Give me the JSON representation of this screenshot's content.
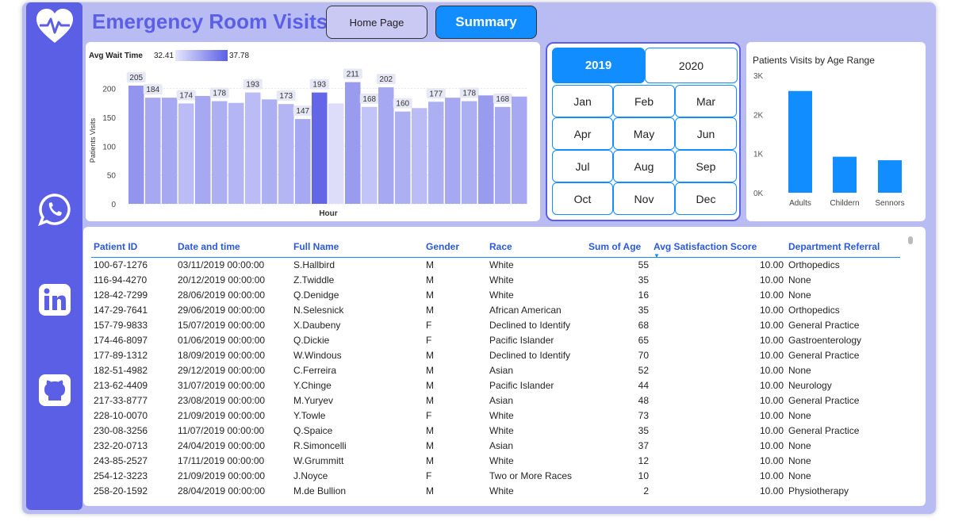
{
  "app": {
    "title": "Emergency Room Visits",
    "home_button": "Home Page",
    "summary_button": "Summary",
    "accent": "#5b5fe6",
    "brand_blue": "#118dff"
  },
  "sidebar": {
    "icons": [
      "heart-pulse-icon",
      "whatsapp-icon",
      "linkedin-icon",
      "github-icon"
    ]
  },
  "chart_data": [
    {
      "type": "bar",
      "title": "",
      "xlabel": "Hour",
      "ylabel": "Patients Visits",
      "ylim": [
        0,
        220
      ],
      "yticks": [
        0,
        50,
        100,
        150,
        200
      ],
      "legend": {
        "label": "Avg Wait Time",
        "min": "32.41",
        "max": "37.78"
      },
      "values": [
        205,
        184,
        184,
        174,
        187,
        178,
        175,
        193,
        181,
        173,
        147,
        193,
        174,
        211,
        168,
        202,
        160,
        166,
        177,
        184,
        178,
        188,
        168,
        186
      ],
      "shade": [
        0.6,
        0.45,
        0.45,
        0.3,
        0.45,
        0.4,
        0.35,
        0.3,
        0.4,
        0.35,
        0.45,
        0.95,
        0.05,
        0.55,
        0.25,
        0.45,
        0.4,
        0.3,
        0.4,
        0.45,
        0.4,
        0.55,
        0.45,
        0.45
      ],
      "labels": [
        "205",
        "184",
        "",
        "174",
        "",
        "178",
        "",
        "193",
        "",
        "173",
        "147",
        "193",
        "",
        "211",
        "168",
        "202",
        "160",
        "",
        "177",
        "",
        "178",
        "",
        "168",
        ""
      ]
    },
    {
      "type": "bar",
      "title": "Patients Visits by Age Range",
      "categories": [
        "Adults",
        "Childern",
        "Sennors"
      ],
      "values": [
        2600,
        920,
        830
      ],
      "ylim": [
        0,
        3000
      ],
      "yticks": [
        "0K",
        "1K",
        "2K",
        "3K"
      ],
      "color": "#118dff"
    }
  ],
  "slicer": {
    "years": [
      "2019",
      "2020"
    ],
    "selected_year": "2019",
    "months": [
      "Jan",
      "Feb",
      "Mar",
      "Apr",
      "May",
      "Jun",
      "Jul",
      "Aug",
      "Sep",
      "Oct",
      "Nov",
      "Dec"
    ]
  },
  "table": {
    "headers": [
      "Patient ID",
      "Date and time",
      "Full Name",
      "Gender",
      "Race",
      "Sum of Age",
      "Avg Satisfaction  Score",
      "Department Referral"
    ],
    "rows": [
      [
        "100-67-1276",
        "03/11/2019 00:00:00",
        "S.Hallbird",
        "M",
        "White",
        "55",
        "10.00",
        "Orthopedics"
      ],
      [
        "116-94-4270",
        "20/12/2019 00:00:00",
        "Z.Twiddle",
        "M",
        "White",
        "35",
        "10.00",
        "None"
      ],
      [
        "128-42-7299",
        "28/06/2019 00:00:00",
        "Q.Denidge",
        "M",
        "White",
        "16",
        "10.00",
        "None"
      ],
      [
        "147-29-7641",
        "29/06/2019 00:00:00",
        "N.Selesnick",
        "M",
        "African American",
        "35",
        "10.00",
        "Orthopedics"
      ],
      [
        "157-79-9833",
        "15/07/2019 00:00:00",
        "X.Daubeny",
        "F",
        "Declined to Identify",
        "68",
        "10.00",
        "General Practice"
      ],
      [
        "174-46-8097",
        "01/06/2019 00:00:00",
        "Q.Dickie",
        "F",
        "Pacific Islander",
        "65",
        "10.00",
        "Gastroenterology"
      ],
      [
        "177-89-1312",
        "18/09/2019 00:00:00",
        "W.Windous",
        "M",
        "Declined to Identify",
        "70",
        "10.00",
        "General Practice"
      ],
      [
        "182-51-4982",
        "29/12/2019 00:00:00",
        "C.Ferreira",
        "M",
        "Asian",
        "52",
        "10.00",
        "None"
      ],
      [
        "213-62-4409",
        "31/07/2019 00:00:00",
        "Y.Chinge",
        "M",
        "Pacific Islander",
        "44",
        "10.00",
        "Neurology"
      ],
      [
        "217-33-8777",
        "23/08/2019 00:00:00",
        "M.Yuryev",
        "M",
        "Asian",
        "48",
        "10.00",
        "General Practice"
      ],
      [
        "228-10-0070",
        "21/09/2019 00:00:00",
        "Y.Towle",
        "F",
        "White",
        "73",
        "10.00",
        "None"
      ],
      [
        "230-08-3256",
        "11/07/2019 00:00:00",
        "Q.Spaice",
        "M",
        "White",
        "35",
        "10.00",
        "General Practice"
      ],
      [
        "232-20-0713",
        "24/04/2019 00:00:00",
        "R.Simoncelli",
        "M",
        "Asian",
        "37",
        "10.00",
        "None"
      ],
      [
        "243-85-2527",
        "17/11/2019 00:00:00",
        "W.Grummitt",
        "M",
        "White",
        "12",
        "10.00",
        "None"
      ],
      [
        "254-12-3223",
        "21/09/2019 00:00:00",
        "J.Noyce",
        "F",
        "Two or More Races",
        "10",
        "10.00",
        "None"
      ],
      [
        "258-20-1592",
        "28/04/2019 00:00:00",
        "M.de Bullion",
        "M",
        "White",
        "2",
        "10.00",
        "Physiotherapy"
      ]
    ]
  }
}
